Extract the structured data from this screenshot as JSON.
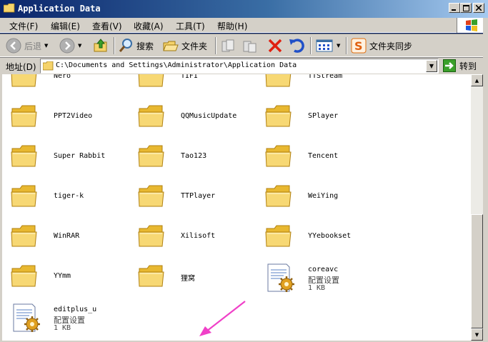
{
  "window": {
    "title": "Application Data"
  },
  "menu": [
    {
      "label": "文件(F)"
    },
    {
      "label": "编辑(E)"
    },
    {
      "label": "查看(V)"
    },
    {
      "label": "收藏(A)"
    },
    {
      "label": "工具(T)"
    },
    {
      "label": "帮助(H)"
    }
  ],
  "toolbar": {
    "back_label": "后退",
    "search_label": "搜索",
    "folders_label": "文件夹",
    "sync_label": "文件夹同步"
  },
  "address": {
    "label": "地址(D)",
    "value": "C:\\Documents and Settings\\Administrator\\Application Data",
    "go_label": "转到"
  },
  "items": [
    {
      "name": "Nero",
      "type": "folder"
    },
    {
      "name": "TIFI",
      "type": "folder"
    },
    {
      "name": "TTStream",
      "type": "folder"
    },
    {
      "name": "PPT2Video",
      "type": "folder"
    },
    {
      "name": "QQMusicUpdate",
      "type": "folder"
    },
    {
      "name": "SPlayer",
      "type": "folder"
    },
    {
      "name": "Super Rabbit",
      "type": "folder"
    },
    {
      "name": "Tao123",
      "type": "folder"
    },
    {
      "name": "Tencent",
      "type": "folder"
    },
    {
      "name": "tiger-k",
      "type": "folder"
    },
    {
      "name": "TTPlayer",
      "type": "folder"
    },
    {
      "name": "WeiYing",
      "type": "folder"
    },
    {
      "name": "WinRAR",
      "type": "folder"
    },
    {
      "name": "Xilisoft",
      "type": "folder"
    },
    {
      "name": "YYebookset",
      "type": "folder"
    },
    {
      "name": "YYmm",
      "type": "folder"
    },
    {
      "name": "狸窝",
      "type": "folder"
    },
    {
      "name": "coreavc",
      "type": "file",
      "ftype": "配置设置",
      "size": "1 KB"
    },
    {
      "name": "editplus_u",
      "type": "file",
      "ftype": "配置设置",
      "size": "1 KB"
    }
  ],
  "colors": {
    "title_start": "#0a246a",
    "title_end": "#a6caf0",
    "chrome": "#d4d0c8",
    "folder": "#f5d36b",
    "annotation_arrow": "#f040c8"
  }
}
